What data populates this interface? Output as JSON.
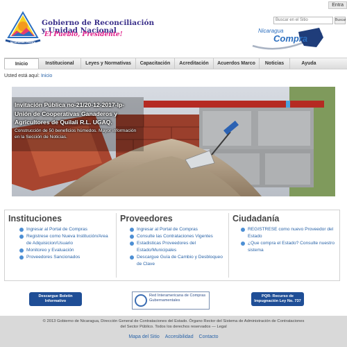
{
  "topbar": {
    "login_label": "Entra"
  },
  "header": {
    "title_line1": "Gobierno de Reconciliación",
    "title_line2": "y Unidad Nacional",
    "slogan": "El Pueblo, Presidente!",
    "logo_text": "NICARAGUA TRIUNFA",
    "compra_top": "Nicaragua",
    "compra_main": "Compra"
  },
  "search": {
    "placeholder": "Buscar en el Sitio",
    "button_label": "Buscar"
  },
  "nav": {
    "items": [
      {
        "label": "Inicio"
      },
      {
        "label": "Institucional"
      },
      {
        "label": "Leyes y Normativas"
      },
      {
        "label": "Capacitación"
      },
      {
        "label": "Acreditación"
      },
      {
        "label": "Acuerdos Marco"
      },
      {
        "label": "Noticias"
      },
      {
        "label": "Ayuda"
      }
    ]
  },
  "breadcrumb": {
    "prefix": "Usted está aquí:",
    "current": "Inicio"
  },
  "hero": {
    "title": "Invitación Pública no-21/20-12-2017-Ip-Unión de Cooperativas Ganaderos y Agricultores de Quilali R.L. UGAQ.",
    "desc": "Construcción de 50 beneficios húmedos. Mayor información en la Sección de Noticias."
  },
  "columns": [
    {
      "title": "Instituciones",
      "links": [
        "Ingresar al Portal de Compras",
        "Registrese como Nueva Institución/Area de Adquisicion/Usuario",
        "Monitoreo y Evaluación",
        "Proveedores Sancionados"
      ]
    },
    {
      "title": "Proveedores",
      "links": [
        "Ingresar al Portal de Compras",
        "Consulte las Contrataciones Vigentes",
        "Estadisticas Proveedores del Estado/Municipales",
        "Descargue Guía de Cambio y Desbloqueo de Clave"
      ]
    },
    {
      "title": "Ciudadanía",
      "links": [
        "REGISTRESE  como nuevo Proveedor del Estado",
        "¿Que  compra el Estado? Consulte nuestro sistema"
      ]
    }
  ],
  "banners": {
    "boletin": "Descargue Boletin Informativo",
    "red": "Red Interamericana de Compras Gubernamentales",
    "pqr": "PQR- Recurso de Impugnación Ley No. 737"
  },
  "footer": {
    "text": "© 2013 Gobierno de Nicaragua, Dirección General de Contrataciones del Estado. Órgano Rector del Sistema de Administración de Contrataciones del Sector Público. Todos los derechos reservados — Legal",
    "links": [
      "Mapa del Sitio",
      "Accesibilidad",
      "Contacto"
    ]
  }
}
